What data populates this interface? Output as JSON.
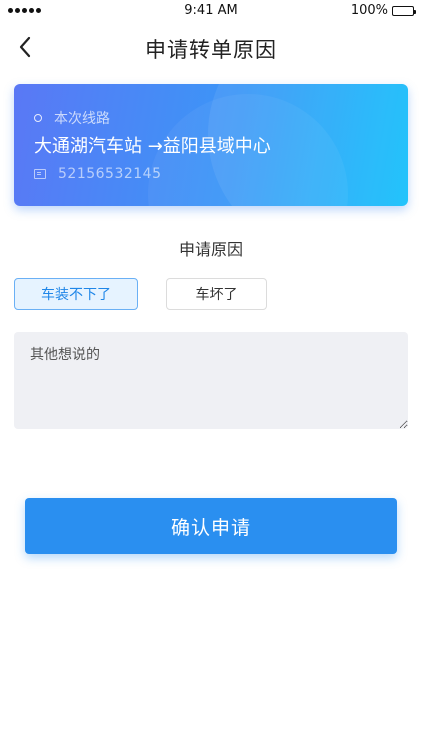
{
  "status_bar": {
    "time": "9:41 AM",
    "battery": "100%"
  },
  "nav": {
    "title": "申请转单原因"
  },
  "route_card": {
    "line_label": "本次线路",
    "route": "大通湖汽车站 →益阳县域中心",
    "order_number": "52156532145"
  },
  "reason": {
    "title": "申请原因",
    "options": [
      {
        "label": "车装不下了",
        "selected": true
      },
      {
        "label": "车坏了",
        "selected": false
      }
    ]
  },
  "note": {
    "placeholder": "其他想说的",
    "value": ""
  },
  "submit": {
    "label": "确认申请"
  },
  "colors": {
    "primary": "#2a8ff0",
    "card_start": "#5a78f5",
    "card_end": "#12c0fb",
    "selected_bg": "#e6f3ff"
  }
}
